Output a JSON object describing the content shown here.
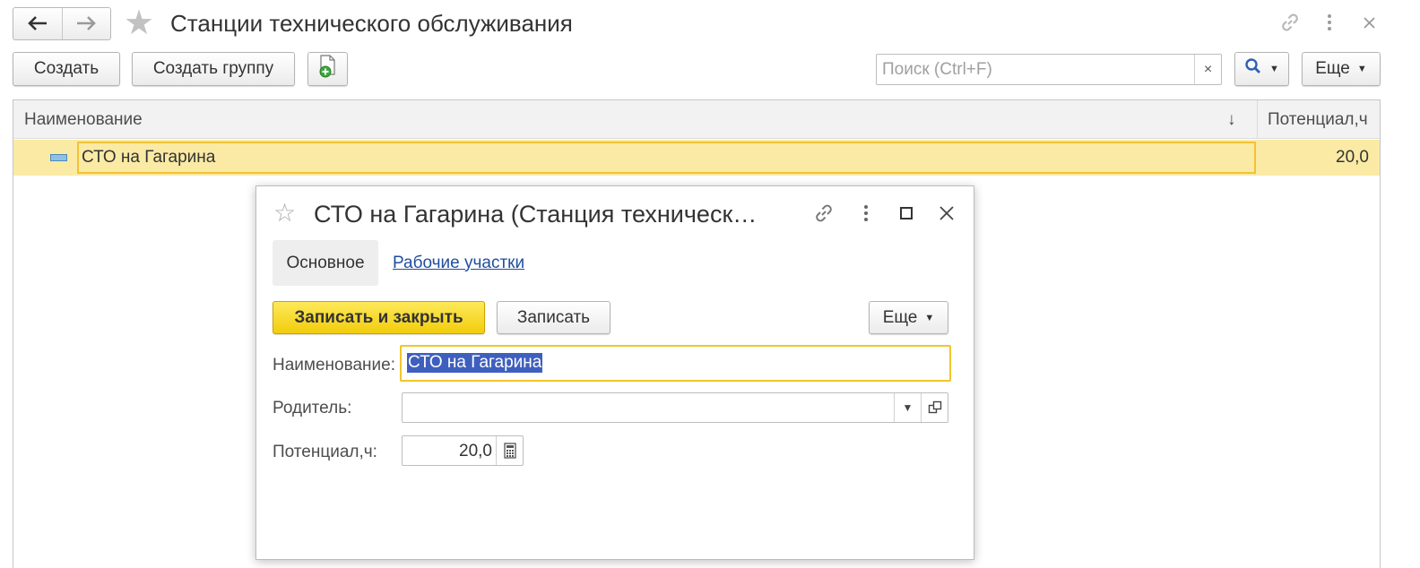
{
  "window": {
    "title": "Станции технического обслуживания",
    "nav": {
      "back": "🡐",
      "forward": "🡒"
    },
    "icons": [
      "star-icon",
      "link-icon",
      "more-icon",
      "close-icon"
    ]
  },
  "toolbar": {
    "create_label": "Создать",
    "create_group_label": "Создать группу",
    "search": {
      "placeholder": "Поиск (Ctrl+F)",
      "value": "",
      "clear": "×"
    },
    "more_label": "Еще"
  },
  "table": {
    "columns": [
      "Наименование",
      "Потенциал,ч"
    ],
    "sort_indicator": "↓",
    "rows": [
      {
        "name": "СТО на Гагарина",
        "potential": "20,0",
        "selected": true
      }
    ]
  },
  "form": {
    "title": "СТО на Гагарина (Станция техническ…",
    "tabs": [
      {
        "label": "Основное",
        "active": true
      },
      {
        "label": "Рабочие участки",
        "active": false
      }
    ],
    "save_close_label": "Записать и закрыть",
    "save_label": "Записать",
    "more_label": "Еще",
    "fields": {
      "name": {
        "label": "Наименование:",
        "value": "СТО на Гагарина"
      },
      "parent": {
        "label": "Родитель:",
        "value": ""
      },
      "potential": {
        "label": "Потенциал,ч:",
        "value": "20,0"
      }
    }
  },
  "colors": {
    "accent_yellow": "#f2cd0c",
    "row_highlight": "#fbeaa4",
    "focus_border": "#f0c62c",
    "link_blue": "#1f4e9e",
    "selection_blue": "#3f5fbf"
  }
}
